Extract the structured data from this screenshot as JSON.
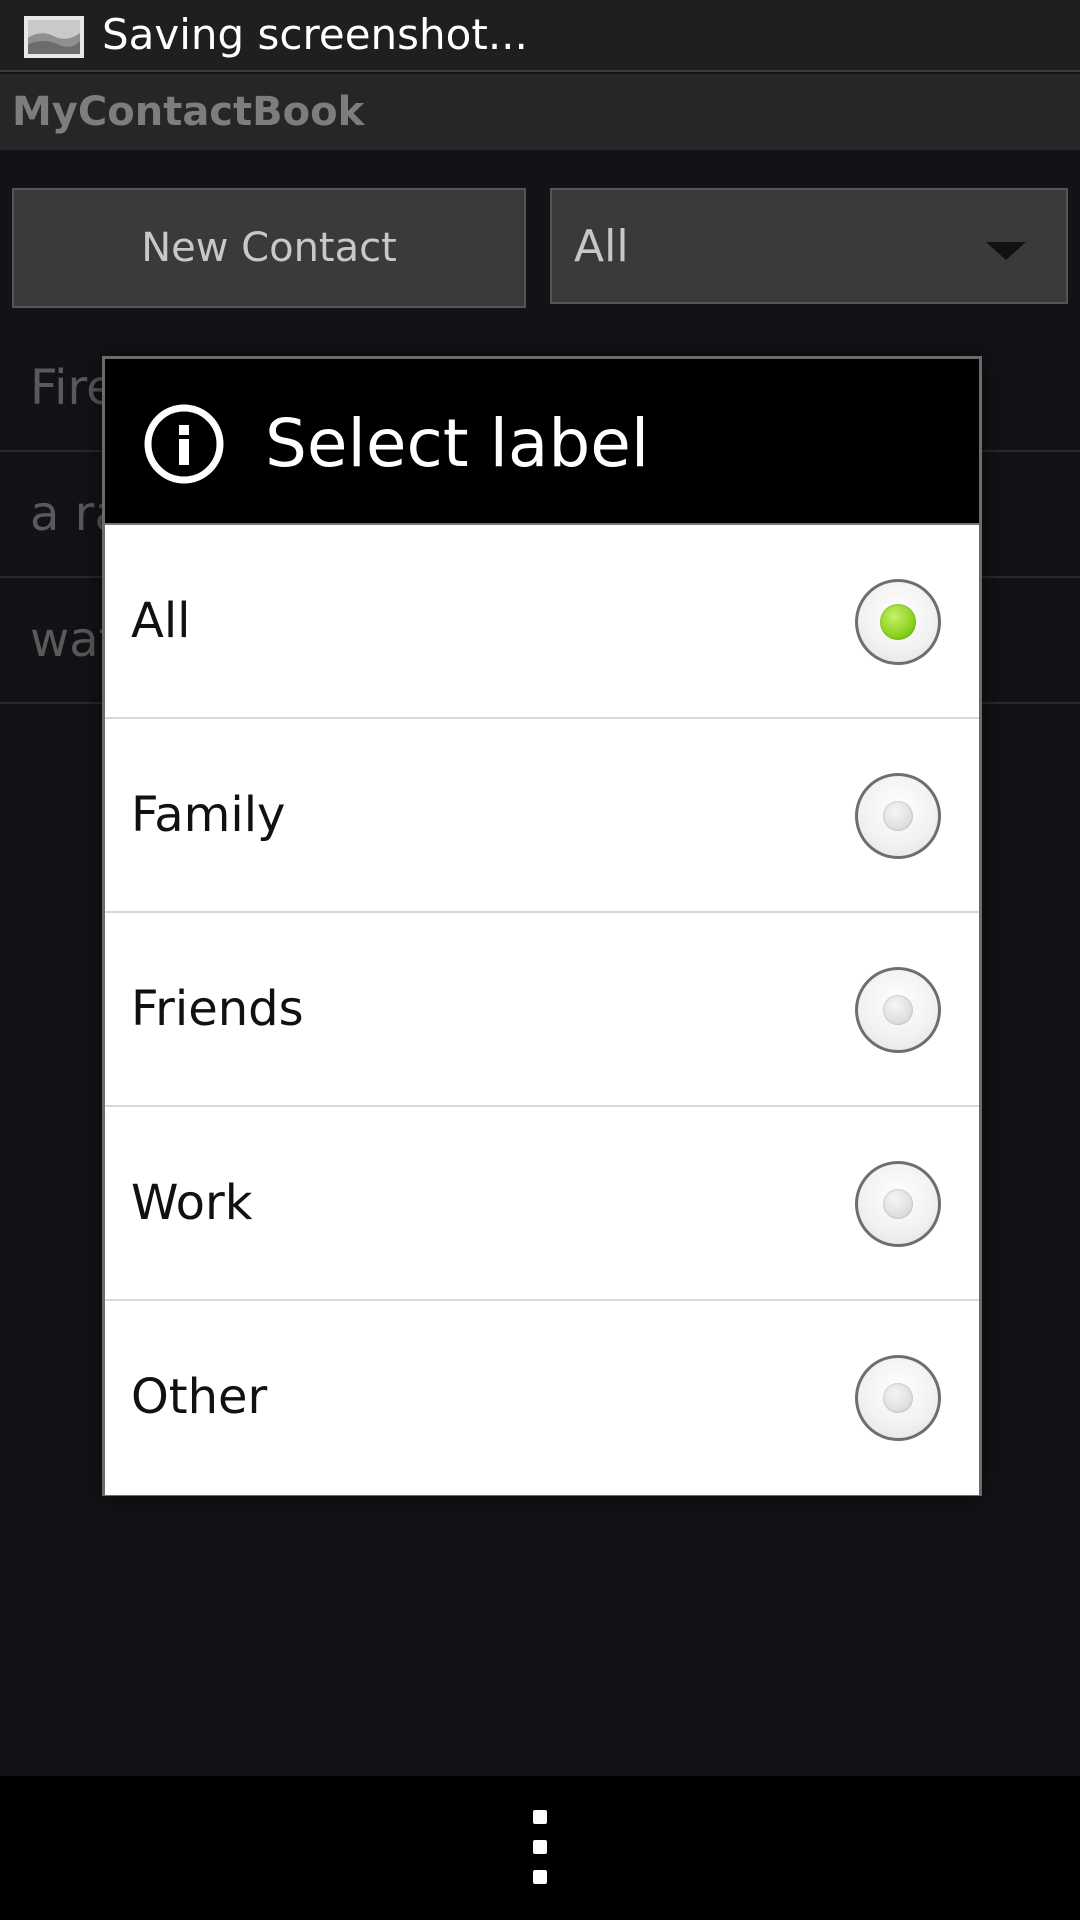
{
  "status_bar": {
    "icon": "screenshot-icon",
    "text": "Saving screenshot..."
  },
  "app_bar": {
    "title": "MyContactBook"
  },
  "toolbar": {
    "new_contact_label": "New Contact",
    "filter_value": "All",
    "filter_icon": "chevron-down-icon"
  },
  "contacts": {
    "items": [
      {
        "name": "Fireball"
      },
      {
        "name": "a random stranger"
      },
      {
        "name": "wat"
      }
    ]
  },
  "dialog": {
    "icon": "info-icon",
    "title": "Select label",
    "selected": "All",
    "accent_color": "#8ad21e",
    "options": [
      {
        "label": "All"
      },
      {
        "label": "Family"
      },
      {
        "label": "Friends"
      },
      {
        "label": "Work"
      },
      {
        "label": "Other"
      }
    ]
  },
  "nav_bar": {
    "icon": "overflow-menu-icon"
  }
}
